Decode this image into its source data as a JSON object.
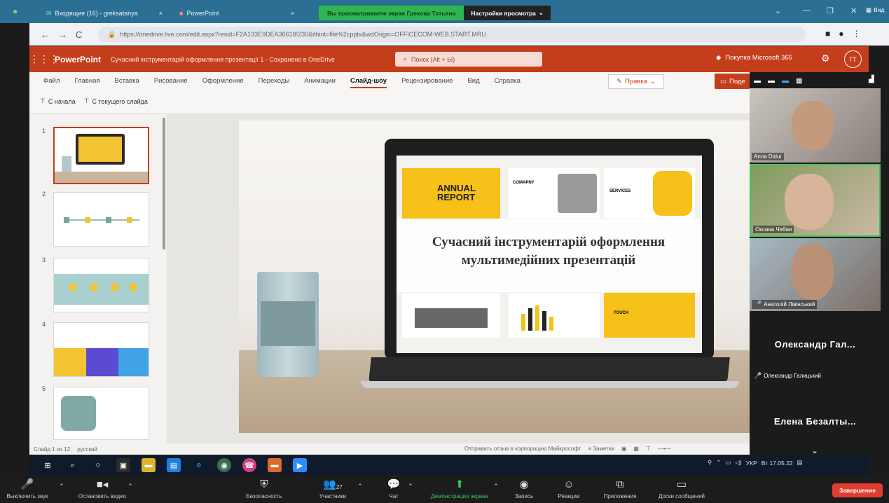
{
  "browser": {
    "tabs": [
      {
        "label": "Входящие (16) - greksatanya",
        "active": false
      },
      {
        "label": "PowerPoint",
        "active": false
      }
    ],
    "url": "https://onedrive.live.com/edit.aspx?resid=F2A133E9DEA36618!230&ithint=file%2cpptx&wdOrigin=OFFICECOM-WEB.START.MRU"
  },
  "zoom_banner": {
    "share_text": "Вы просматриваете экран Грекова Татьяна",
    "view_options": "Настройки просмотра"
  },
  "window_label": "Вид",
  "powerpoint": {
    "app_name": "PowerPoint",
    "doc_title": "Сучасний інструментарій оформлення презентації 1  -  Сохранено в OneDrive",
    "search_placeholder": "Поиск (Alt + Ы)",
    "buy_label": "Покупка Microsoft 365",
    "avatar_initials": "ГТ",
    "menu": [
      "Файл",
      "Главная",
      "Вставка",
      "Рисование",
      "Оформление",
      "Переходы",
      "Анимации",
      "Слайд-шоу",
      "Рецензирование",
      "Вид",
      "Справка"
    ],
    "active_menu": "Слайд-шоу",
    "edit_mode": "Правка",
    "present_label": "Поде",
    "commands": [
      "С начала",
      "С текущего слайда"
    ]
  },
  "slides_panel": {
    "numbers": [
      "1",
      "2",
      "3",
      "4",
      "5"
    ]
  },
  "slide": {
    "title_line1": "Сучасний інструментарій оформлення",
    "title_line2": "мультимедійних презентацій",
    "screen_annual": "ANNUAL",
    "screen_report": "REPORT",
    "screen_company": "COMAPNY",
    "screen_services": "SERVICES",
    "screen_touch": "TOUCH"
  },
  "status": {
    "slide_info": "Слайд 1 из 12",
    "language": "русский",
    "feedback": "Отправить отзыв в корпорацию Майкрософт",
    "notes": "Заметки"
  },
  "participants": [
    {
      "name": "Anna Didur"
    },
    {
      "name": "Оксана Чебан"
    },
    {
      "name": "Анатолій Лівінський"
    }
  ],
  "name_tiles": [
    {
      "display": "Олександр Гал...",
      "label": "Олександр Галицький"
    },
    {
      "display": "Елена Безалты..."
    }
  ],
  "tray": {
    "lang": "УКР",
    "date": "Вт 17.05.22"
  },
  "zoom_controls": {
    "mute": "Выключить звук",
    "stop_video": "Остановить видео",
    "security": "Безопасность",
    "participants": "Участники",
    "participants_count": "27",
    "chat": "Чат",
    "share": "Демонстрация экрана",
    "record": "Запись",
    "reactions": "Реакции",
    "apps": "Приложения",
    "whiteboards": "Доски сообщений",
    "end": "Завершение"
  }
}
